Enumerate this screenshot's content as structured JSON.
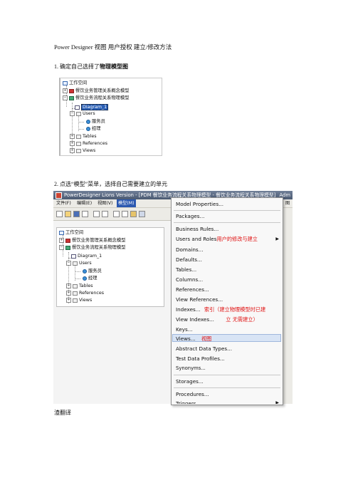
{
  "doc": {
    "title": "Power Designer  视图  用户授权  建立/修改方法",
    "step1": {
      "prefix": "1.  确定自己选择了",
      "bold": "物理模型图"
    },
    "step2": "2.  点选“模型”菜单，选择自己需要建立的单元",
    "footer": "渣翻译"
  },
  "tree": {
    "workspace": "工作空间",
    "cdm": "餐饮业务管理关系概念模型",
    "pdm": "餐饮业务流程关系物理模型",
    "diagram": "Diagram_1",
    "users": "Users",
    "user1": "服务员",
    "user2": "经理",
    "tables": "Tables",
    "references": "References",
    "views": "Views"
  },
  "app": {
    "title": "PowerDesigner Lions Version - [PDM 餐饮业务流程关系物理模型 - 餐饮业务流程关系物理模型]",
    "title_right": "Adm",
    "menus": [
      "文件(F)",
      "编辑(E)",
      "视图(V)",
      "模型(M)"
    ],
    "menu_right": "图",
    "tree": {
      "workspace": "工作空间",
      "cdm": "餐饮业务管理关系概念模型",
      "pdm": "餐饮业务流程关系物理模型",
      "diagram": "Diagram_1",
      "users": "Users",
      "user1": "服务员",
      "user2": "经理",
      "tables": "Tables",
      "references": "References",
      "views": "Views"
    }
  },
  "menu": {
    "model_properties": "Model Properties...",
    "packages": "Packages...",
    "business_rules": "Business Rules...",
    "users_and_roles": "Users and Roles",
    "domains": "Domains...",
    "defaults": "Defaults...",
    "tables": "Tables...",
    "columns": "Columns...",
    "references": "References...",
    "view_references": "View References...",
    "indexes": "Indexes...",
    "view_indexes": "View Indexes...",
    "keys": "Keys...",
    "views": "Views...",
    "abstract_data_types": "Abstract Data Types...",
    "test_data_profiles": "Test Data Profiles...",
    "synonyms": "Synonyms...",
    "storages": "Storages...",
    "procedures": "Procedures...",
    "triggers": "Triggers"
  },
  "annotations": {
    "users": "用户的修改与建立",
    "indexes_line1": "索引（建立物理模型时已建",
    "indexes_line2": "立  无需建立）",
    "views": "视图"
  },
  "colors": {
    "annotation_red": "#e01010",
    "selection_blue": "#2a5fb5",
    "menu_highlight": "#d8e4f5"
  }
}
